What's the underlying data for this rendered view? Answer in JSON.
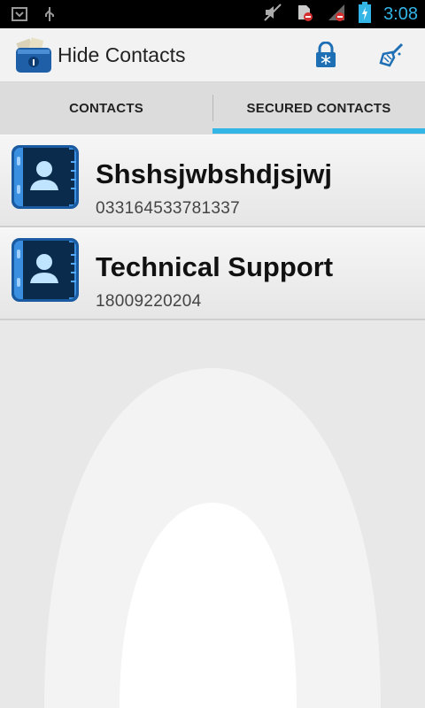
{
  "status_bar": {
    "time": "3:08",
    "icons": [
      "notification-box-icon",
      "usb-icon",
      "mute-icon",
      "no-sim-icon",
      "no-signal-icon",
      "battery-charging-icon"
    ]
  },
  "action_bar": {
    "title": "Hide Contacts",
    "icons": [
      "app-lock-box-icon",
      "lock-icon",
      "broom-icon"
    ]
  },
  "tabs": [
    {
      "label": "CONTACTS",
      "selected": false
    },
    {
      "label": "SECURED CONTACTS",
      "selected": true
    }
  ],
  "contacts": [
    {
      "name": "Shshsjwbshdjsjwj",
      "phone": "033164533781337"
    },
    {
      "name": "Technical Support",
      "phone": "18009220204"
    }
  ],
  "colors": {
    "accent": "#33b5e5",
    "icon_blue": "#1f6fb5"
  }
}
